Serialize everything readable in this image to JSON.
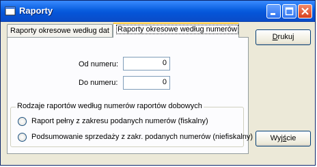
{
  "window": {
    "title": "Raporty"
  },
  "tabs": [
    {
      "label": "Raporty okresowe według dat",
      "active": false
    },
    {
      "label": "Raporty okresowe według numerów",
      "active": true
    }
  ],
  "form": {
    "from_label": "Od numeru:",
    "from_value": "0",
    "to_label": "Do numeru:",
    "to_value": "0"
  },
  "group": {
    "title": "Rodzaje raportów według numerów raportów dobowych",
    "options": [
      {
        "label": "Raport pełny z zakresu podanych numerów (fiskalny)",
        "selected": false
      },
      {
        "label": "Podsumowanie sprzedaży z zakr. podanych numerów (niefiskalny)",
        "selected": false
      }
    ]
  },
  "buttons": {
    "print_label_pre": "",
    "print_label_u": "D",
    "print_label_post": "rukuj",
    "exit_label_pre": "Wyj",
    "exit_label_u": "ś",
    "exit_label_post": "cie"
  },
  "icons": [
    "app-icon",
    "minimize-icon",
    "maximize-icon",
    "close-icon"
  ]
}
